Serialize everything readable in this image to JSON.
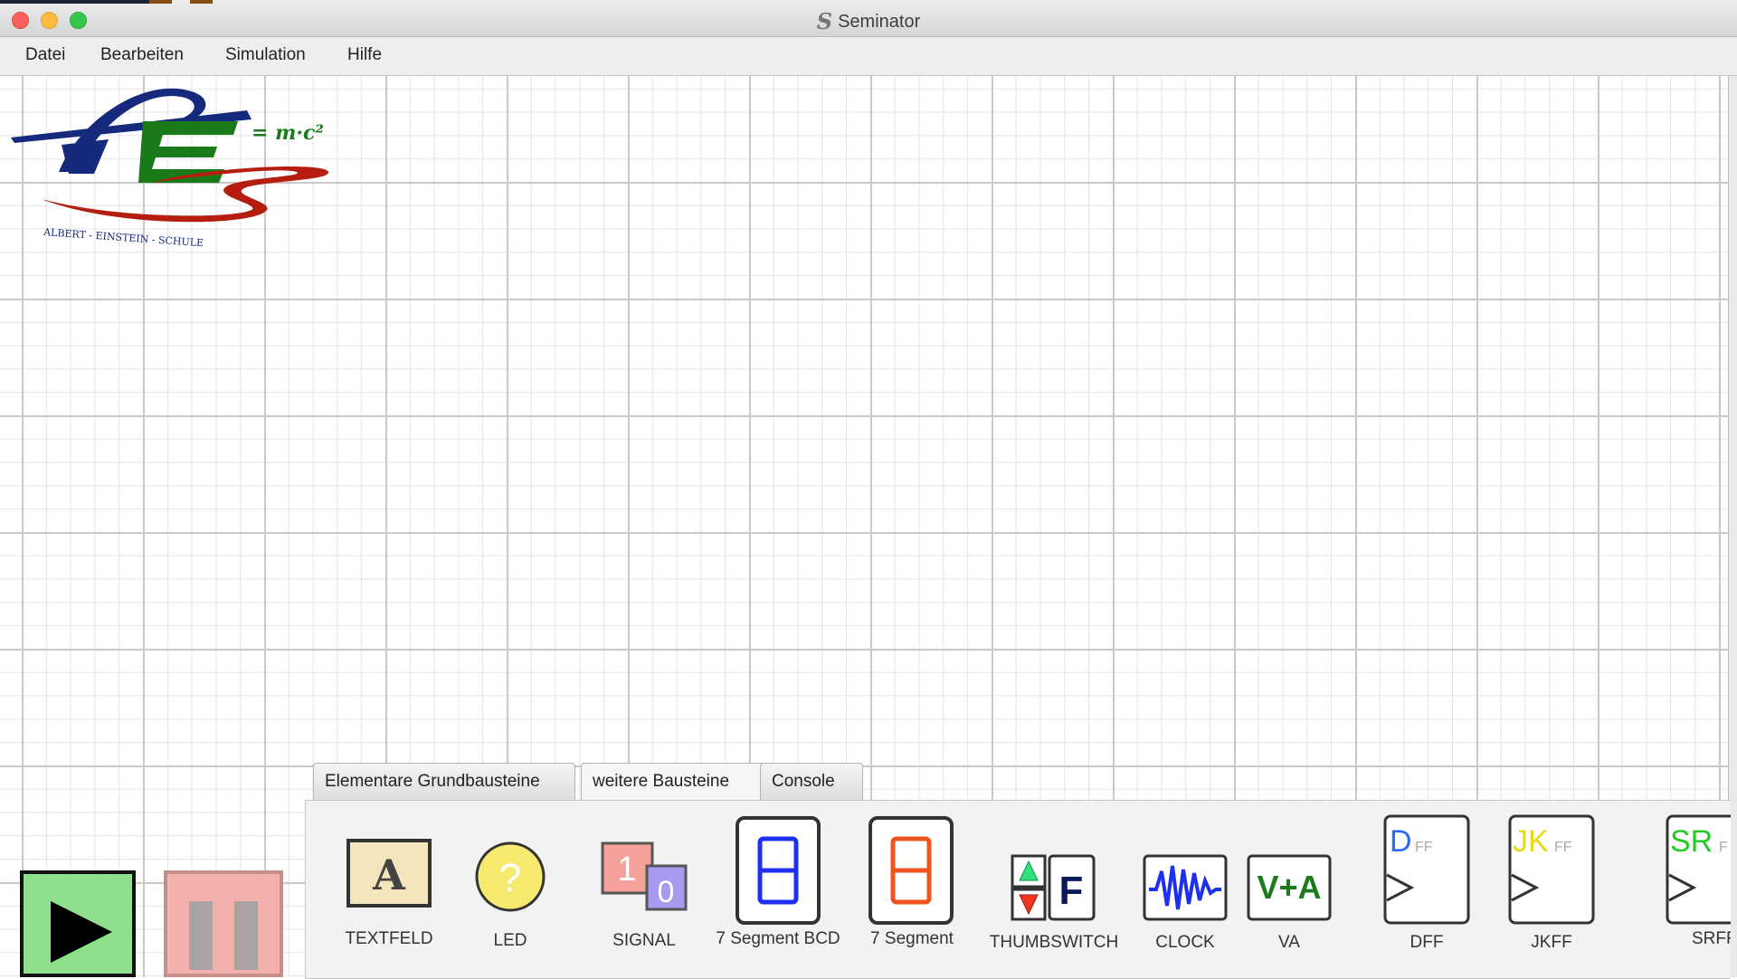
{
  "window": {
    "title": "Seminator",
    "icon": "seminator-s-icon",
    "icon_glyph": "S"
  },
  "menu": {
    "items": [
      "Datei",
      "Bearbeiten",
      "Simulation",
      "Hilfe"
    ]
  },
  "logo": {
    "icon": "albert-einstein-schule-logo",
    "formula": "= m·c²",
    "caption": "ALBERT - EINSTEIN - SCHULE"
  },
  "palette": {
    "tabs": [
      "Elementare Grundbausteine",
      "weitere Bausteine",
      "Console"
    ],
    "active_tab": "weitere Bausteine",
    "components": [
      {
        "label": "TEXTFELD",
        "glyph": "A"
      },
      {
        "label": "LED",
        "glyph": "?"
      },
      {
        "label": "SIGNAL",
        "glyph_top": "1",
        "glyph_bottom": "0"
      },
      {
        "label": "7 Segment BCD"
      },
      {
        "label": "7 Segment"
      },
      {
        "label": "THUMBSWITCH",
        "glyph": "F"
      },
      {
        "label": "CLOCK"
      },
      {
        "label": "VA",
        "glyph": "V+A"
      },
      {
        "label": "DFF",
        "glyph": "D",
        "sub": "FF"
      },
      {
        "label": "JKFF",
        "glyph": "JK",
        "sub": "FF"
      },
      {
        "label": "SRFF",
        "glyph": "SR",
        "sub": "F"
      }
    ]
  },
  "controls": {
    "play_icon": "play-icon",
    "pause_icon": "pause-icon"
  },
  "colors": {
    "bcd_blue": "#1f2ff0",
    "seg_orange": "#f0541e",
    "led_yellow": "#f6ea6e",
    "clock_blue": "#1f2ff0",
    "va_green": "#1e7a1e",
    "dff_blue": "#2a6cf0",
    "jk_yellow": "#e8d81a",
    "sr_green": "#22cc22",
    "play_green": "#8ee08e",
    "pause_red": "#f3b0ad",
    "logo_blue": "#152a7c",
    "logo_green": "#1a7a1a",
    "logo_red": "#b51d10"
  }
}
